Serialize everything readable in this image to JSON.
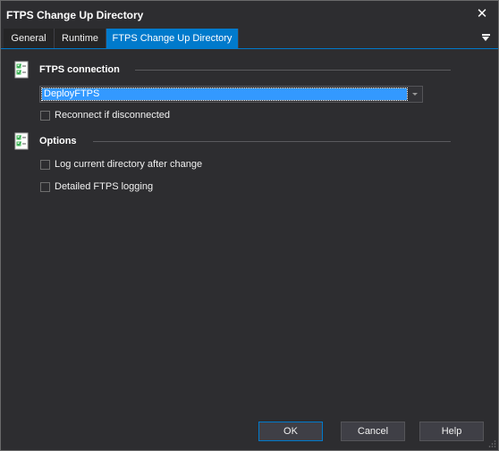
{
  "window": {
    "title": "FTPS Change Up Directory"
  },
  "tabs": [
    {
      "label": "General"
    },
    {
      "label": "Runtime"
    },
    {
      "label": "FTPS Change Up Directory"
    }
  ],
  "sections": {
    "connection": {
      "title": "FTPS connection",
      "selected_connection": "DeployFTPS",
      "reconnect_label": "Reconnect if disconnected",
      "reconnect_checked": false
    },
    "options": {
      "title": "Options",
      "log_directory_label": "Log current directory after change",
      "log_directory_checked": false,
      "detailed_logging_label": "Detailed FTPS logging",
      "detailed_logging_checked": false
    }
  },
  "buttons": {
    "ok": "OK",
    "cancel": "Cancel",
    "help": "Help"
  },
  "colors": {
    "background": "#2d2d30",
    "accent": "#007acc",
    "selection": "#3399ff",
    "icon_green": "#3fb950"
  }
}
